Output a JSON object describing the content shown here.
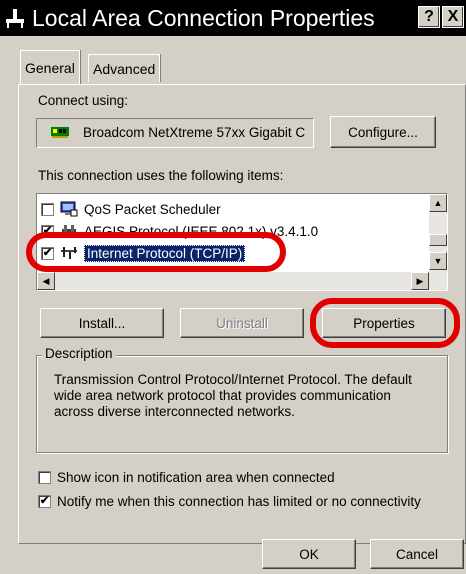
{
  "window": {
    "title": "Local Area Connection Properties",
    "help_button": "?",
    "close_button": "X"
  },
  "tabs": [
    {
      "label": "General",
      "selected": true
    },
    {
      "label": "Advanced",
      "selected": false
    }
  ],
  "connect_using": {
    "label": "Connect using:",
    "adapter": "Broadcom NetXtreme 57xx Gigabit C",
    "configure_button": "Configure..."
  },
  "items_section": {
    "label": "This connection uses the following items:",
    "items": [
      {
        "label": "QoS Packet Scheduler",
        "checked": false,
        "icon": "scheduler-icon"
      },
      {
        "label": "AEGIS Protocol (IEEE 802.1x) v3.4.1.0",
        "checked": true,
        "icon": "protocol-icon"
      },
      {
        "label": "Internet Protocol (TCP/IP)",
        "checked": true,
        "icon": "network-protocol-icon",
        "selected": true
      }
    ]
  },
  "buttons": {
    "install": "Install...",
    "uninstall": "Uninstall",
    "properties": "Properties"
  },
  "description": {
    "label": "Description",
    "text": "Transmission Control Protocol/Internet Protocol. The default wide area network protocol that provides communication across diverse interconnected networks."
  },
  "options": [
    {
      "label": "Show icon in notification area when connected",
      "checked": false
    },
    {
      "label": "Notify me when this connection has limited or no connectivity",
      "checked": true
    }
  ],
  "footer": {
    "ok": "OK",
    "cancel": "Cancel"
  },
  "annotation_color": "#e00000"
}
